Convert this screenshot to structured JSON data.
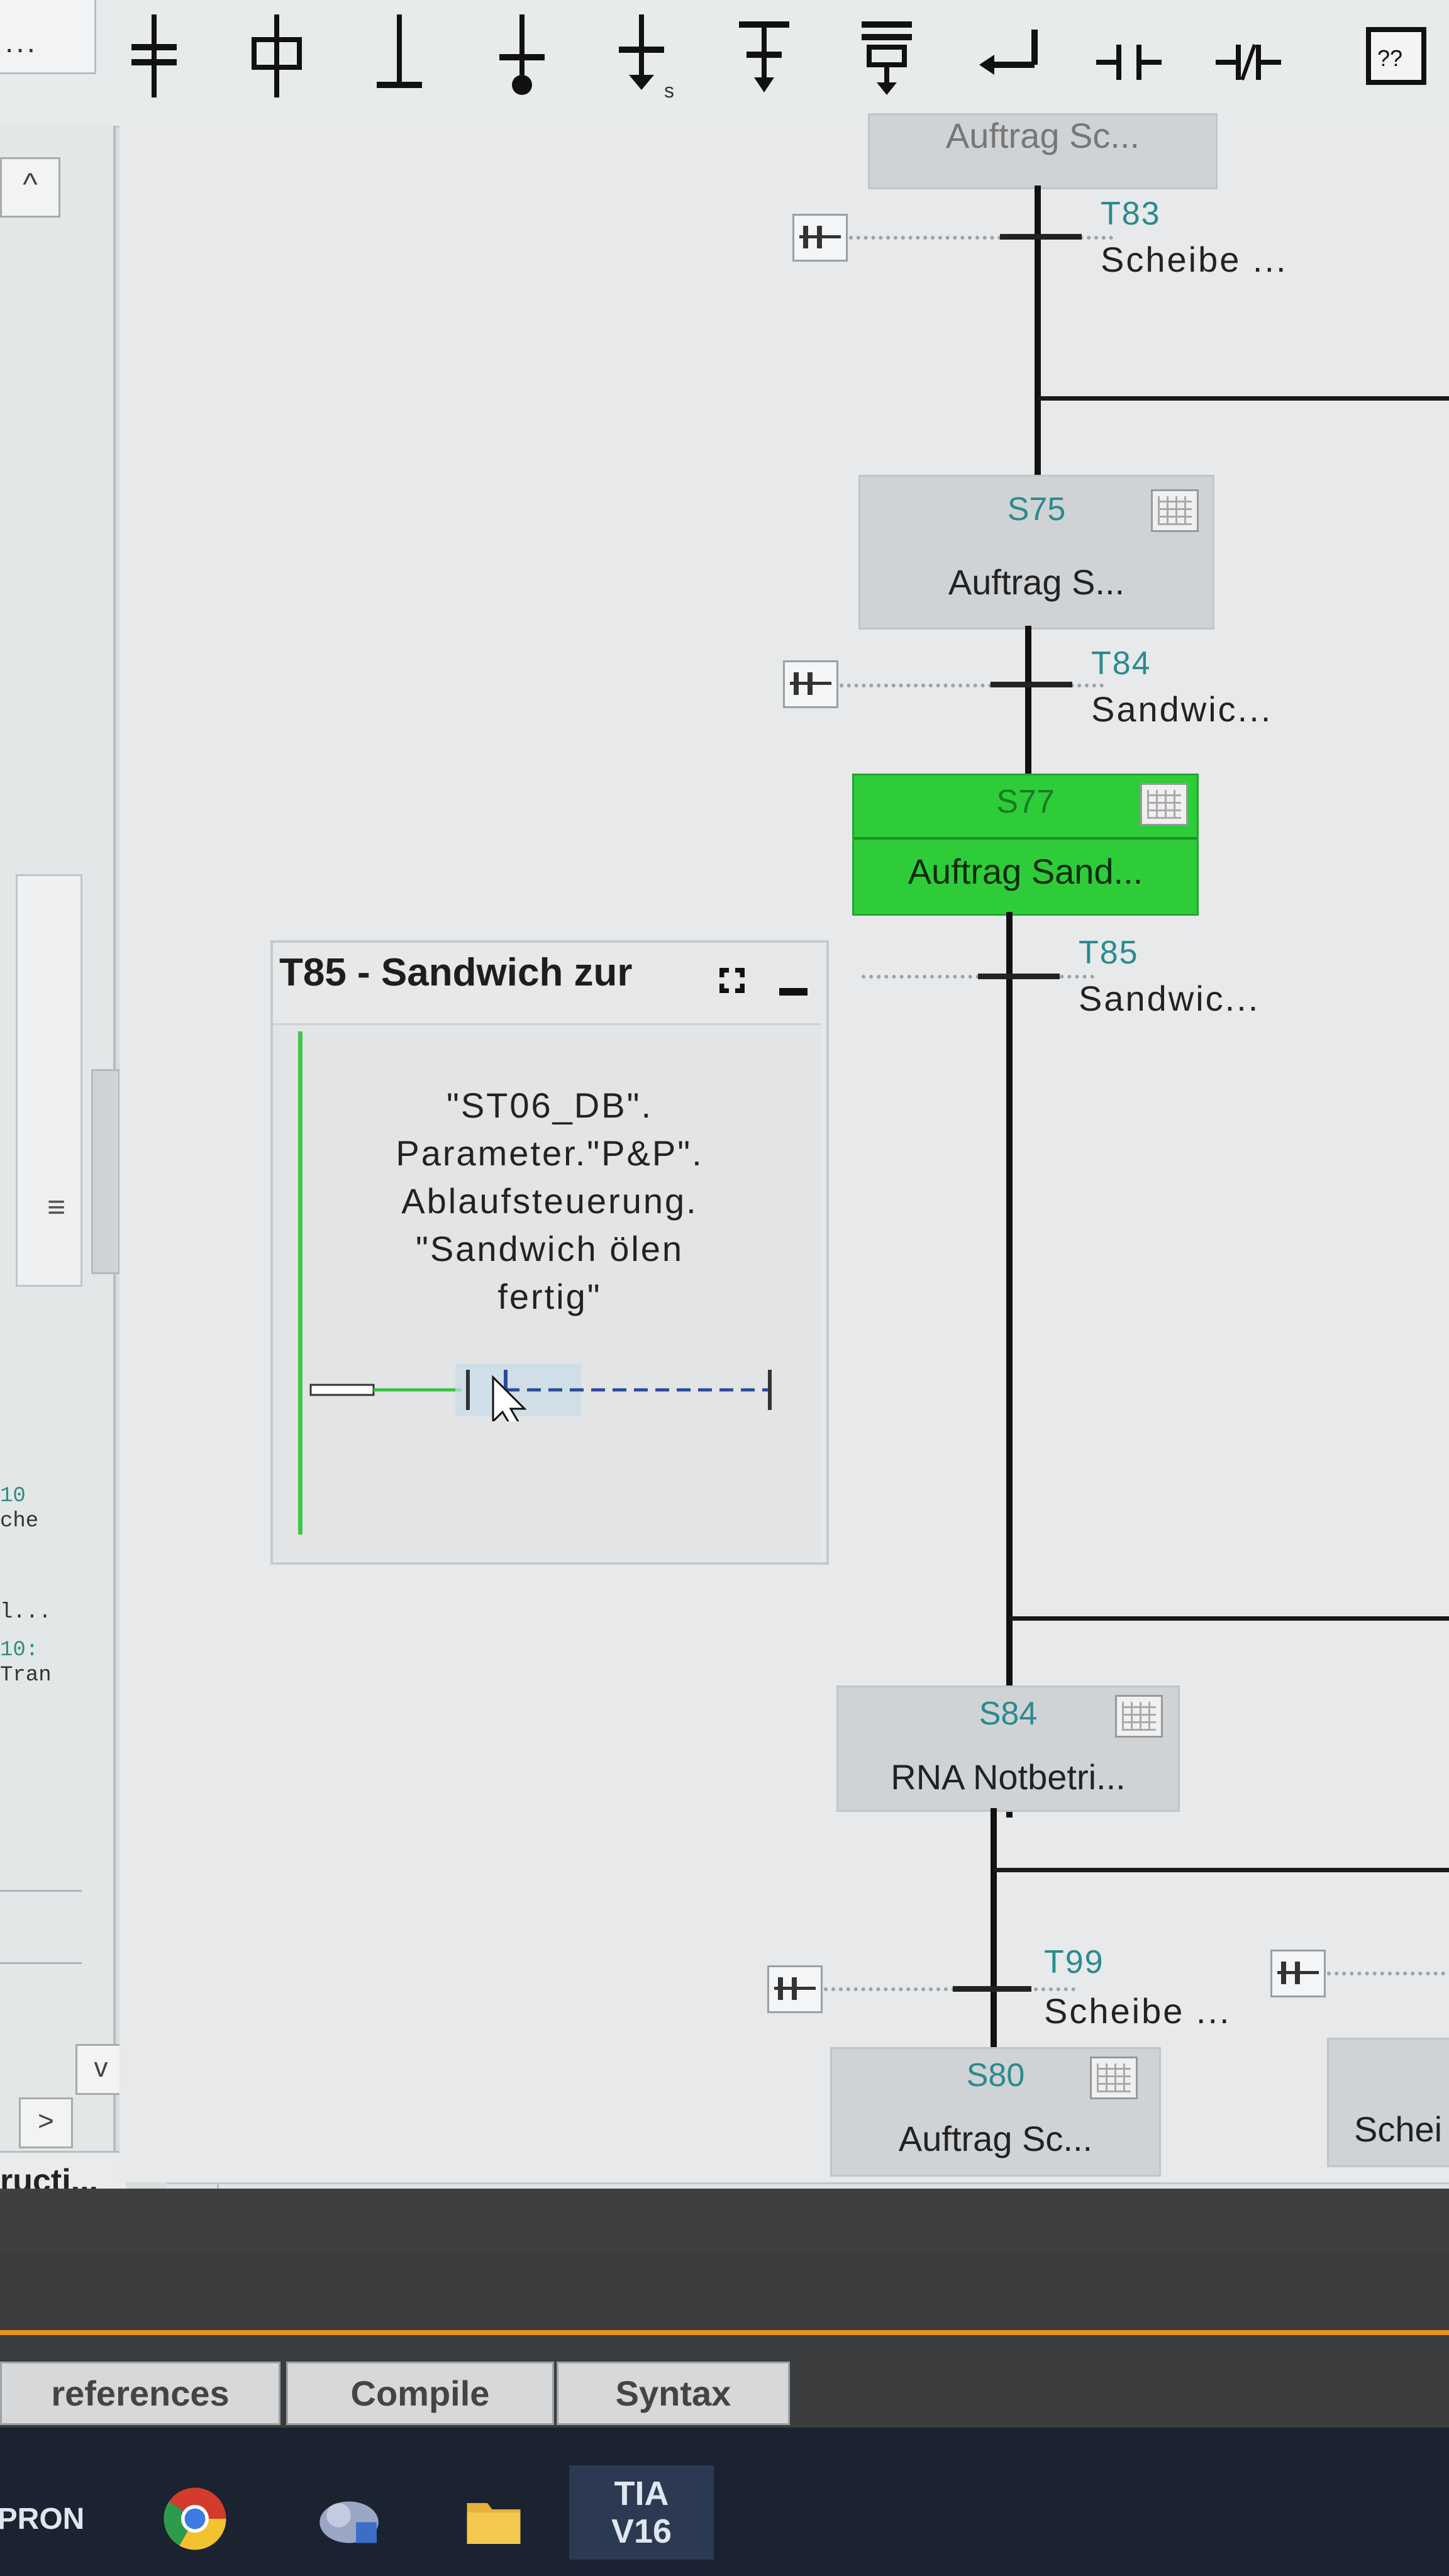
{
  "toolbar": {
    "left_menu_text": "..."
  },
  "sidebar": {
    "scroll_up_glyph": "^",
    "scroll_down_glyph": "v",
    "expand_glyph": ">",
    "grip_glyph": "≡",
    "truncated_label": "ructi...",
    "snippets": [
      "10",
      "che",
      "l...",
      "10:",
      "Tran"
    ]
  },
  "graph": {
    "top_partial_step_name": "Auftrag Sc...",
    "transitions": [
      {
        "id": "T83",
        "name": "Scheibe ..."
      },
      {
        "id": "T84",
        "name": "Sandwic..."
      },
      {
        "id": "T85",
        "name": "Sandwic..."
      },
      {
        "id": "T99",
        "name": "Scheibe ..."
      }
    ],
    "steps": [
      {
        "id": "S75",
        "name": "Auftrag S...",
        "active": false
      },
      {
        "id": "S77",
        "name": "Auftrag Sand...",
        "active": true
      },
      {
        "id": "S84",
        "name": "RNA Notbetri...",
        "active": false
      },
      {
        "id": "S80",
        "name": "Auftrag Sc...",
        "active": false
      }
    ],
    "right_partial_label": "Schei"
  },
  "popup": {
    "title": "T85 - Sandwich zur",
    "condition_text": "\"ST06_DB\".\nParameter.\"P&P\".\nAblaufsteuerung.\n\"Sandwich ölen\nfertig\""
  },
  "bottom_tabs": [
    {
      "label": "references"
    },
    {
      "label": "Compile"
    },
    {
      "label": "Syntax"
    }
  ],
  "taskbar": {
    "items": [
      "PRON",
      "chrome-icon",
      "app-icon",
      "folder-icon",
      "TIA V16"
    ],
    "tia_label_top": "TIA",
    "tia_label_bottom": "V16",
    "pron_label": "PRON"
  },
  "colors": {
    "active_step": "#2fcc3a",
    "teal_id": "#2b8a8f",
    "accent_orange": "#e8941c"
  }
}
